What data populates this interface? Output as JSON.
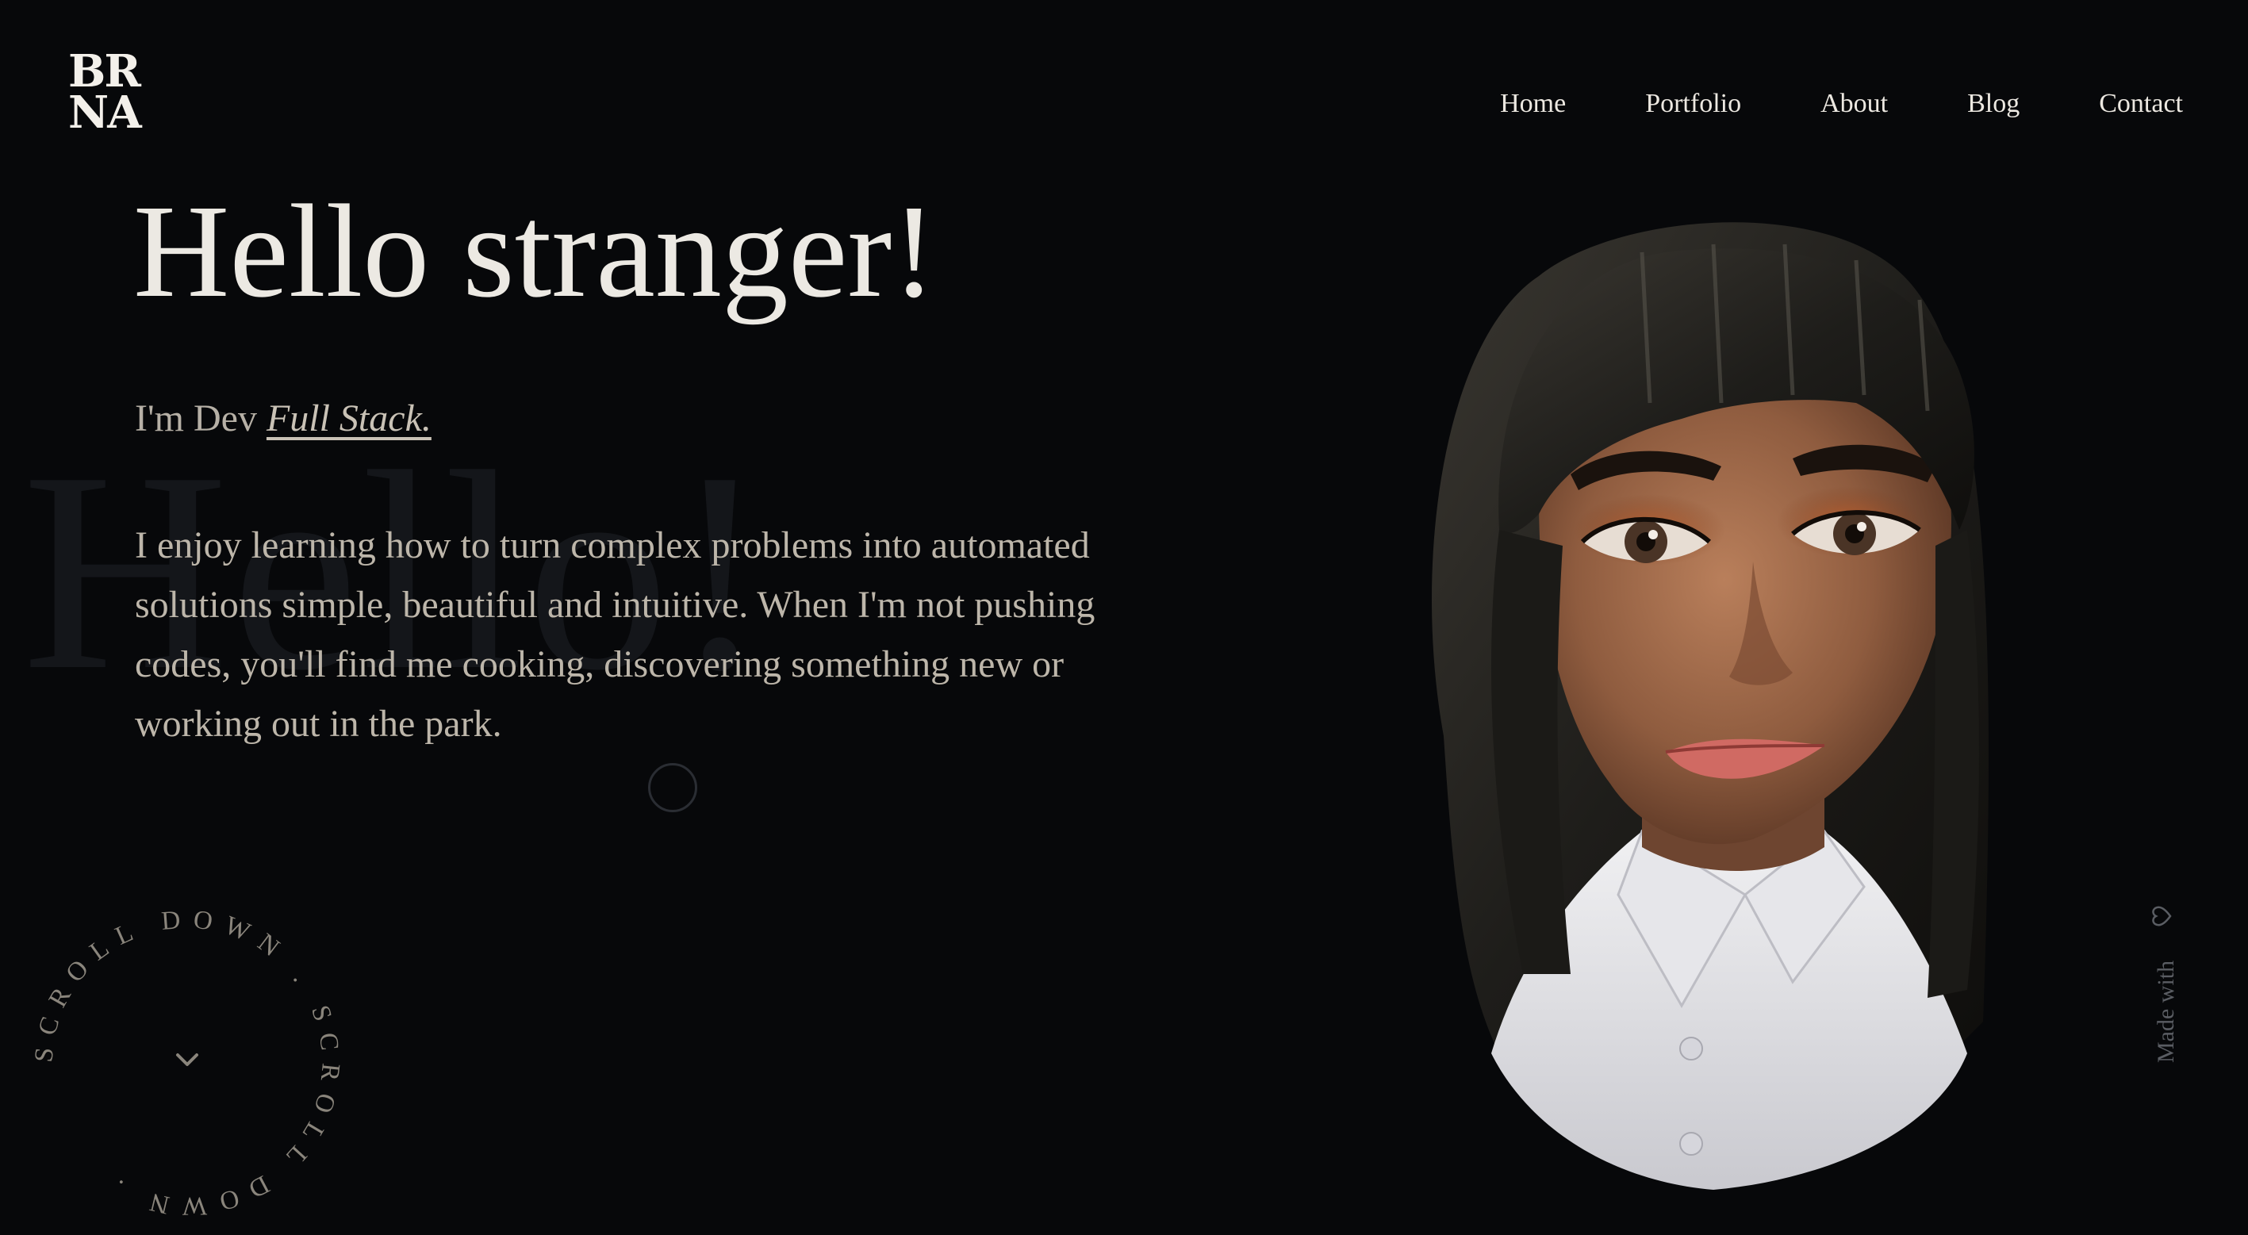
{
  "logo": {
    "line1": "BR",
    "line2": "NA"
  },
  "nav": {
    "items": [
      {
        "label": "Home"
      },
      {
        "label": "Portfolio"
      },
      {
        "label": "About"
      },
      {
        "label": "Blog"
      },
      {
        "label": "Contact"
      }
    ]
  },
  "hero": {
    "background_word": "Hello!",
    "title": "Hello stranger!",
    "intro_prefix": "I'm Dev ",
    "intro_role": "Full Stack.",
    "bio": "I enjoy learning how to turn complex problems into automated solutions simple, beautiful and intuitive. When I'm not pushing codes, you'll find me cooking, discovering something new or working out in the park."
  },
  "scroll_indicator": {
    "text": "SCROLL DOWN . SCROLL DOWN . ",
    "icon": "chevron-down-icon"
  },
  "footer_badge": {
    "label": "Made with",
    "icon": "heart-icon"
  },
  "colors": {
    "background": "#07080a",
    "text_primary": "#ece9e3",
    "text_secondary": "#bdb6aa",
    "muted": "#5a5d63"
  }
}
